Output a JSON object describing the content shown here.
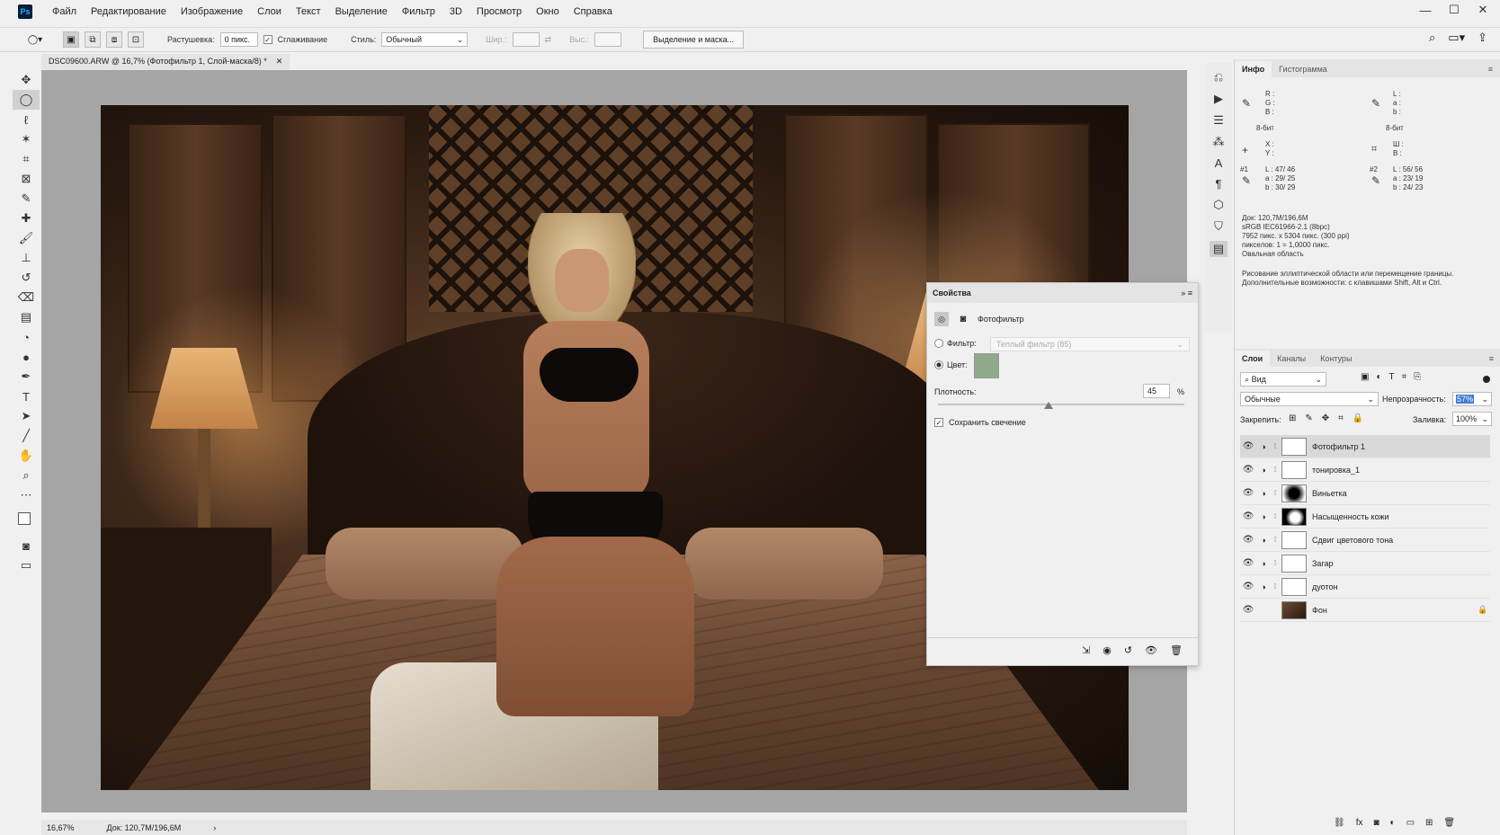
{
  "app": {
    "logo": "Ps"
  },
  "menu": [
    "Файл",
    "Редактирование",
    "Изображение",
    "Слои",
    "Текст",
    "Выделение",
    "Фильтр",
    "3D",
    "Просмотр",
    "Окно",
    "Справка"
  ],
  "options": {
    "feather_label": "Растушевка:",
    "feather_value": "0 пикс.",
    "antialias_label": "Сглаживание",
    "style_label": "Стиль:",
    "style_value": "Обычный",
    "width_label": "Шир.:",
    "height_label": "Выс.:",
    "mask_button": "Выделение и маска..."
  },
  "document": {
    "tab_title": "DSC09600.ARW @ 16,7% (Фотофильтр 1, Слой-маска/8) *",
    "zoom": "16,67%",
    "doc_size": "Док: 120,7M/196,6M"
  },
  "info_panel": {
    "tabs": [
      "Инфо",
      "Гистограмма"
    ],
    "rgb_labels": [
      "R :",
      "G :",
      "B :"
    ],
    "lab_labels": [
      "L :",
      "a :",
      "b :"
    ],
    "bit_left": "8-бит",
    "bit_right": "8-бит",
    "xy_labels": [
      "X :",
      "Y :"
    ],
    "wh_labels": [
      "Ш :",
      "В :"
    ],
    "sampler1_label": "#1",
    "sampler1": [
      "L :   47/ 46",
      "a :   29/ 25",
      "b :   30/ 29"
    ],
    "sampler2_label": "#2",
    "sampler2": [
      "L :   56/ 56",
      "a :   23/ 19",
      "b :   24/ 23"
    ],
    "doc_info": [
      "Док: 120,7M/196,6M",
      "sRGB IEC61966-2.1 (8bpc)",
      "7952 пикс. x 5304 пикс. (300 ppi)",
      "пикселов: 1 = 1,0000 пикс.",
      "Овальная область"
    ],
    "hint": [
      "Рисование эллиптической области или перемещение границы.",
      "Дополнительные возможности: с клавишами Shift, Alt и Ctrl."
    ]
  },
  "layers_panel": {
    "tabs": [
      "Слои",
      "Каналы",
      "Контуры"
    ],
    "search": "Вид",
    "blend_mode": "Обычные",
    "opacity_label": "Непрозрачность:",
    "opacity_value": "57%",
    "lock_label": "Закрепить:",
    "fill_label": "Заливка:",
    "fill_value": "100%",
    "layers": [
      {
        "name": "Фотофильтр 1",
        "selected": true,
        "mask": "white"
      },
      {
        "name": "тонировка_1",
        "selected": false,
        "mask": "white"
      },
      {
        "name": "Виньетка",
        "selected": false,
        "mask": "vignette"
      },
      {
        "name": "Насыщенность кожи",
        "selected": false,
        "mask": "figure"
      },
      {
        "name": "Сдвиг цветового тона",
        "selected": false,
        "mask": "white"
      },
      {
        "name": "Загар",
        "selected": false,
        "mask": "white"
      },
      {
        "name": "дуотон",
        "selected": false,
        "mask": "white"
      },
      {
        "name": "Фон",
        "selected": false,
        "mask": "photo"
      }
    ]
  },
  "properties": {
    "title": "Свойства",
    "type_label": "Фотофильтр",
    "filter_label": "Фильтр:",
    "filter_value": "Теплый фильтр (85)",
    "color_label": "Цвет:",
    "color_swatch": "#8fa98a",
    "density_label": "Плотность:",
    "density_value": "45",
    "density_unit": "%",
    "density_fraction": 0.45,
    "preserve_label": "Сохранить свечение"
  },
  "colors": {
    "accent": "#3d7bd6"
  }
}
